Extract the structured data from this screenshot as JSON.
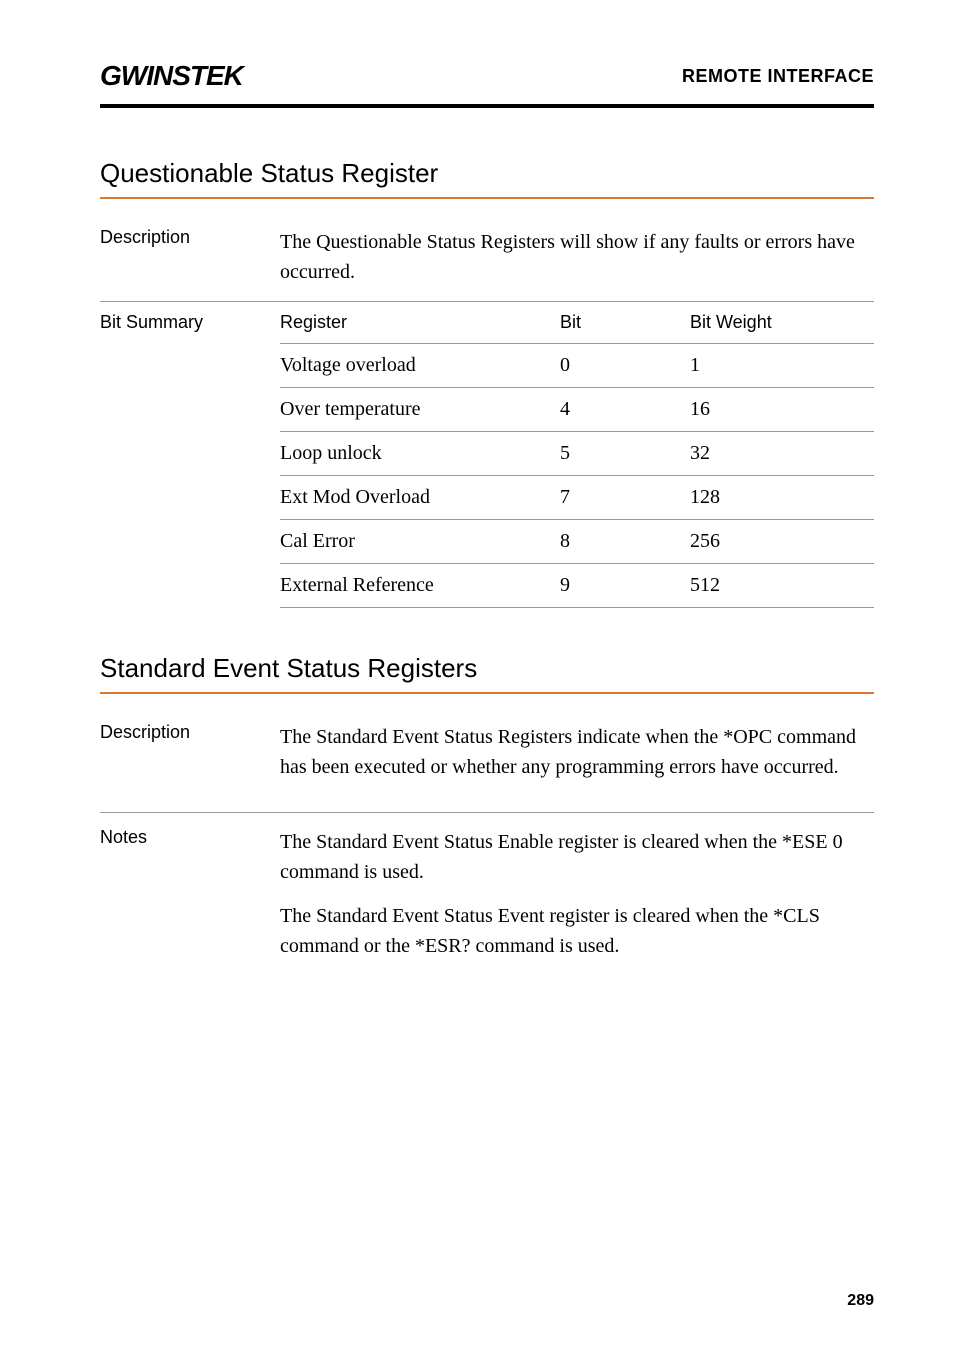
{
  "header": {
    "logo": "GWINSTEK",
    "right": "REMOTE INTERFACE"
  },
  "section1": {
    "title": "Questionable Status Register",
    "descLabel": "Description",
    "description": "The Questionable Status Registers will show if any faults or errors have occurred.",
    "bitSummaryLabel": "Bit Summary",
    "headers": {
      "register": "Register",
      "bit": "Bit",
      "weight": "Bit Weight"
    },
    "rows": [
      {
        "register": "Voltage overload",
        "bit": "0",
        "weight": "1"
      },
      {
        "register": "Over temperature",
        "bit": "4",
        "weight": "16"
      },
      {
        "register": "Loop unlock",
        "bit": "5",
        "weight": "32"
      },
      {
        "register": "Ext Mod Overload",
        "bit": "7",
        "weight": "128"
      },
      {
        "register": "Cal Error",
        "bit": "8",
        "weight": "256"
      },
      {
        "register": "External Reference",
        "bit": "9",
        "weight": "512"
      }
    ]
  },
  "section2": {
    "title": "Standard Event Status Registers",
    "descLabel": "Description",
    "description": "The Standard Event Status Registers indicate when the *OPC command has been executed or whether any programming errors have occurred.",
    "notesLabel": "Notes",
    "notesPara1": "The Standard Event Status Enable register is cleared when the *ESE 0 command is used.",
    "notesPara2": "The Standard Event Status Event register is cleared when the *CLS command or the *ESR? command is used."
  },
  "pageNum": "289"
}
